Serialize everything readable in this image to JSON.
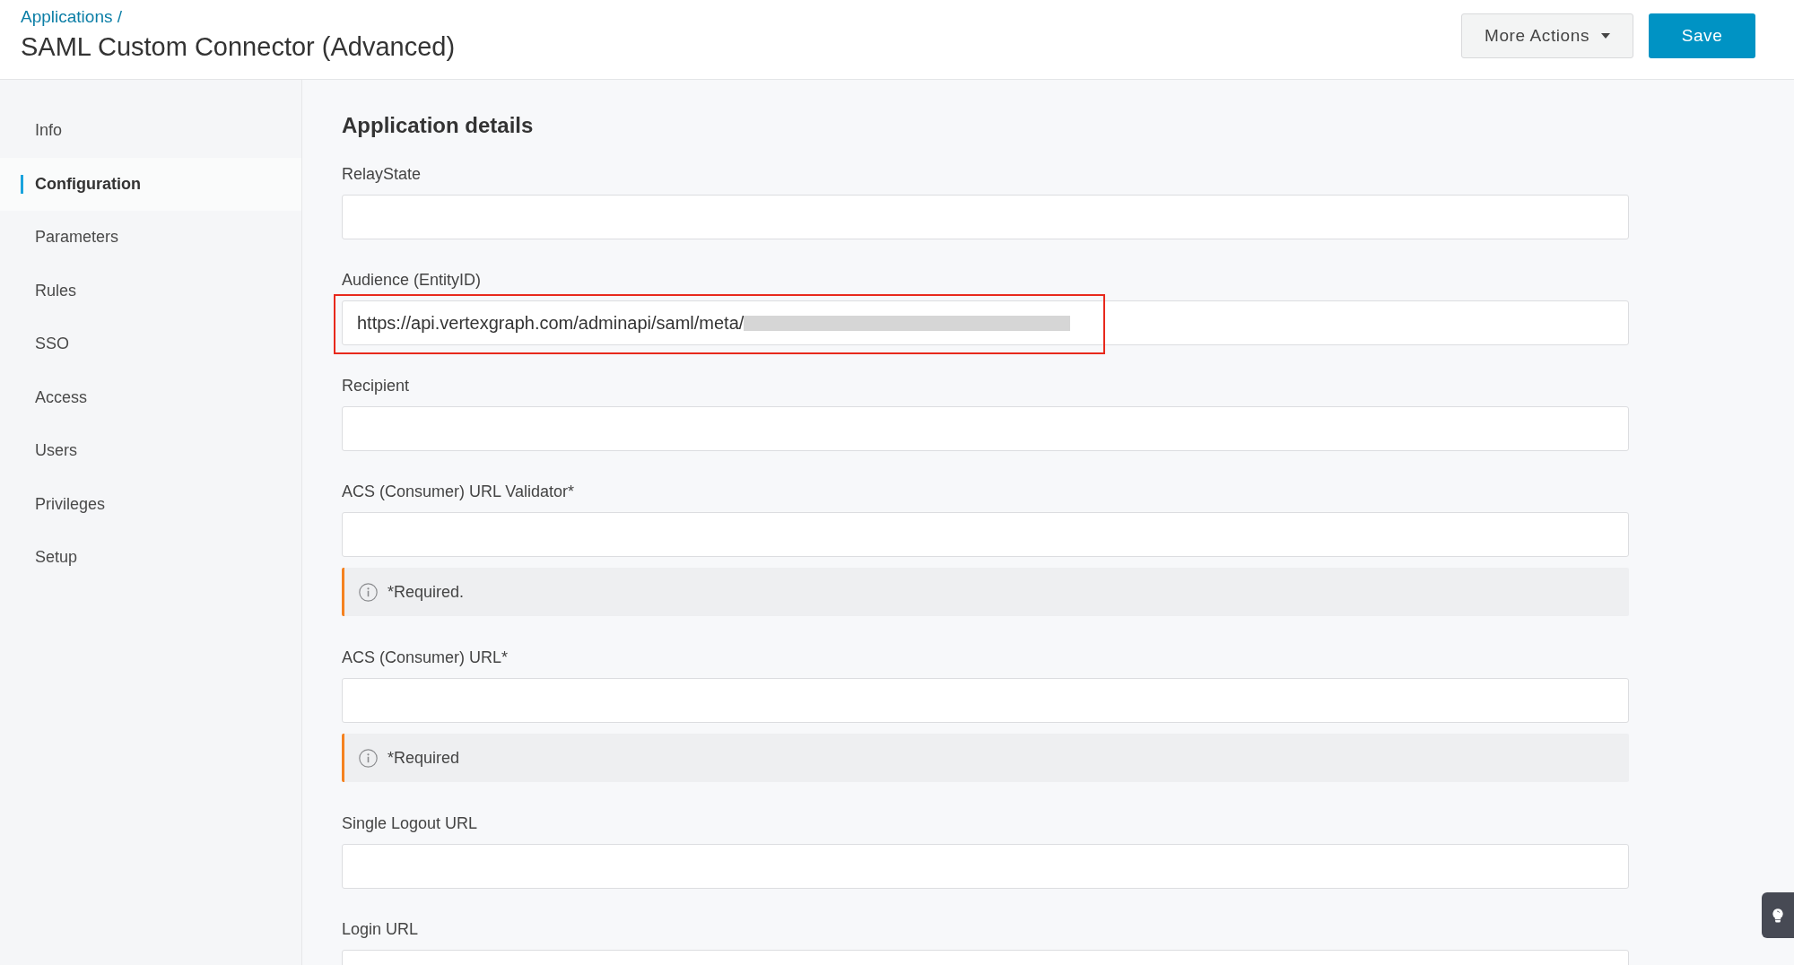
{
  "header": {
    "breadcrumb": "Applications /",
    "title": "SAML Custom Connector (Advanced)",
    "actions": [
      {
        "label": "More Actions",
        "kind": "dropdown"
      },
      {
        "label": "Save",
        "kind": "primary"
      }
    ]
  },
  "sidebar": {
    "items": [
      {
        "label": "Info",
        "selected": false
      },
      {
        "label": "Configuration",
        "selected": true
      },
      {
        "label": "Parameters",
        "selected": false
      },
      {
        "label": "Rules",
        "selected": false
      },
      {
        "label": "SSO",
        "selected": false
      },
      {
        "label": "Access",
        "selected": false
      },
      {
        "label": "Users",
        "selected": false
      },
      {
        "label": "Privileges",
        "selected": false
      },
      {
        "label": "Setup",
        "selected": false
      }
    ]
  },
  "details": {
    "heading": "Application details",
    "fields": [
      {
        "label": "RelayState",
        "highlighted": false,
        "redacted": false
      },
      {
        "label": "Audience (EntityID)",
        "value": "https://api.vertexgraph.com/adminapi/saml/meta/",
        "highlighted": true,
        "redacted": true
      },
      {
        "label": "Recipient",
        "highlighted": false,
        "redacted": false
      },
      {
        "label": "ACS (Consumer) URL Validator*",
        "note": "*Required.",
        "highlighted": false,
        "redacted": false
      },
      {
        "label": "ACS (Consumer) URL*",
        "note": "*Required",
        "highlighted": false,
        "redacted": false
      },
      {
        "label": "Single Logout URL",
        "highlighted": false,
        "redacted": false
      },
      {
        "label": "Login URL",
        "highlighted": false,
        "redacted": false
      }
    ]
  }
}
